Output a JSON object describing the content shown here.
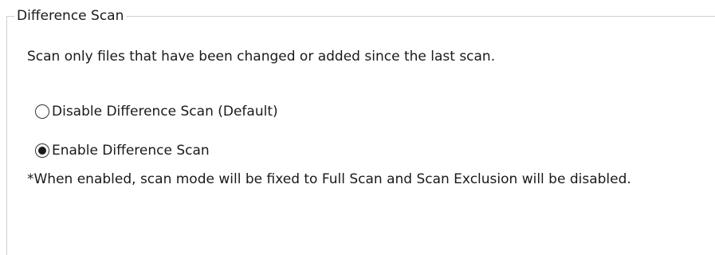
{
  "group": {
    "title": "Difference Scan",
    "description": "Scan only files that have been changed or added since the last scan.",
    "options": [
      {
        "label": "Disable Difference Scan (Default)",
        "checked": false
      },
      {
        "label": "Enable Difference Scan",
        "checked": true
      }
    ],
    "note": "*When enabled, scan mode will be fixed to Full Scan and Scan Exclusion will be disabled."
  }
}
